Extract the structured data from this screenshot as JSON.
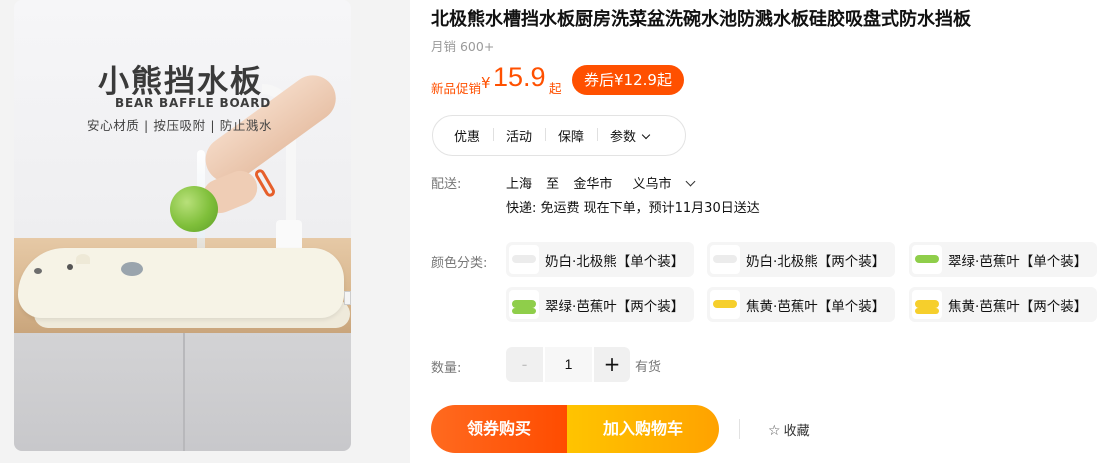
{
  "image": {
    "title": "小熊挡水板",
    "subtitle": "BEAR BAFFLE BOARD",
    "features": "安心材质 | 按压吸附 | 防止溅水"
  },
  "product": {
    "title": "北极熊水槽挡水板厨房洗菜盆洗碗水池防溅水板硅胶吸盘式防水挡板",
    "sales": "月销 600+"
  },
  "price": {
    "label": "新品促销",
    "currency": "¥",
    "value": "15.9",
    "suffix": "起",
    "coupon": "券后¥12.9起",
    "color": "#ff5000"
  },
  "tabs": [
    "优惠",
    "活动",
    "保障",
    "参数"
  ],
  "shipping": {
    "label": "配送:",
    "from": "上海",
    "to_word": "至",
    "city": "金华市",
    "district": "义乌市",
    "detail": "快递: 免运费  现在下单，预计11月30日送达"
  },
  "color_options": {
    "label": "颜色分类:",
    "items": [
      {
        "label": "奶白·北极熊【单个装】",
        "swatch": "#ececec"
      },
      {
        "label": "奶白·北极熊【两个装】",
        "swatch": "#ececec"
      },
      {
        "label": "翠绿·芭蕉叶【单个装】",
        "swatch": "#8fce4a"
      },
      {
        "label": "翠绿·芭蕉叶【两个装】",
        "swatch": "#8fce4a"
      },
      {
        "label": "焦黄·芭蕉叶【单个装】",
        "swatch": "#f6cf2c"
      },
      {
        "label": "焦黄·芭蕉叶【两个装】",
        "swatch": "#f6cf2c"
      }
    ]
  },
  "quantity": {
    "label": "数量:",
    "value": "1",
    "minus": "-",
    "plus": "+",
    "stock": "有货"
  },
  "actions": {
    "buy": "领券购买",
    "cart": "加入购物车",
    "favorite": "收藏",
    "buy_color": "#ff5000",
    "cart_color": "#ffb300"
  }
}
